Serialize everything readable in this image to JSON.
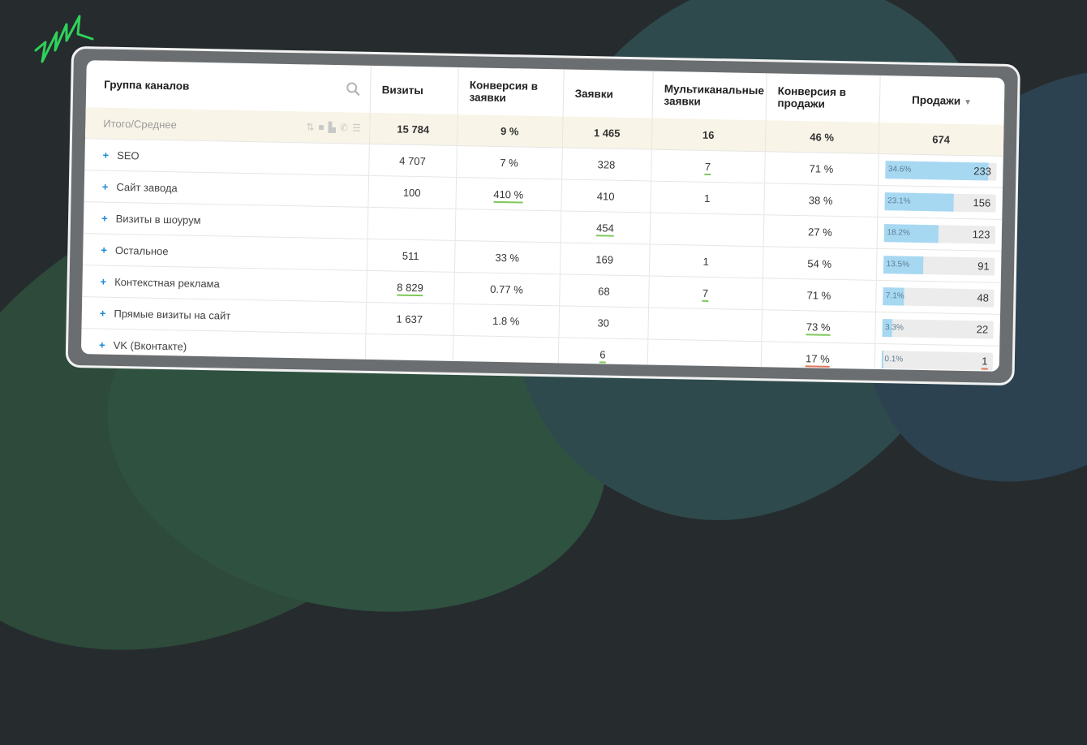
{
  "table": {
    "headers": {
      "group": "Группа каналов",
      "visits": "Визиты",
      "conv_leads": "Конверсия в заявки",
      "leads": "Заявки",
      "multi": "Мультиканальные заявки",
      "conv_sales": "Конверсия в продажи",
      "sales": "Продажи"
    },
    "total": {
      "label": "Итого/Среднее",
      "visits": "15 784",
      "conv_leads": "9 %",
      "leads": "1 465",
      "multi": "16",
      "conv_sales": "46 %",
      "sales": "674"
    },
    "rows": [
      {
        "label": "SEO",
        "visits": "4 707",
        "conv_leads": "7 %",
        "leads": "328",
        "multi": "7",
        "conv_sales": "71 %",
        "sales_pct": "34.6%",
        "sales": "233",
        "share": 0.346
      },
      {
        "label": "Сайт завода",
        "visits": "100",
        "conv_leads": "410 %",
        "leads": "410",
        "multi": "1",
        "conv_sales": "38 %",
        "sales_pct": "23.1%",
        "sales": "156",
        "share": 0.231
      },
      {
        "label": "Визиты в шоурум",
        "visits": "",
        "conv_leads": "",
        "leads": "454",
        "multi": "",
        "conv_sales": "27 %",
        "sales_pct": "18.2%",
        "sales": "123",
        "share": 0.182
      },
      {
        "label": "Остальное",
        "visits": "511",
        "conv_leads": "33 %",
        "leads": "169",
        "multi": "1",
        "conv_sales": "54 %",
        "sales_pct": "13.5%",
        "sales": "91",
        "share": 0.135
      },
      {
        "label": "Контекстная реклама",
        "visits": "8 829",
        "conv_leads": "0.77 %",
        "leads": "68",
        "multi": "7",
        "conv_sales": "71 %",
        "sales_pct": "7.1%",
        "sales": "48",
        "share": 0.071
      },
      {
        "label": "Прямые визиты на сайт",
        "visits": "1 637",
        "conv_leads": "1.8 %",
        "leads": "30",
        "multi": "",
        "conv_sales": "73 %",
        "sales_pct": "3.3%",
        "sales": "22",
        "share": 0.033
      },
      {
        "label": "VK (Вконтакте)",
        "visits": "",
        "conv_leads": "",
        "leads": "6",
        "multi": "",
        "conv_sales": "17 %",
        "sales_pct": "0.1%",
        "sales": "1",
        "share": 0.001
      }
    ],
    "plus_symbol": "+",
    "sort_indicator": "▼"
  },
  "icons": [
    "search-icon",
    "sort-icon",
    "square-icon",
    "chart-icon",
    "phone-icon",
    "list-icon",
    "sparkle-doodle-icon"
  ],
  "colors": {
    "accent_blue": "#1a8ad6",
    "bar_fill": "#a7d8f2",
    "underline_green": "#7ec95a",
    "underline_red": "#e0785a",
    "total_bg": "#f8f4e7"
  }
}
